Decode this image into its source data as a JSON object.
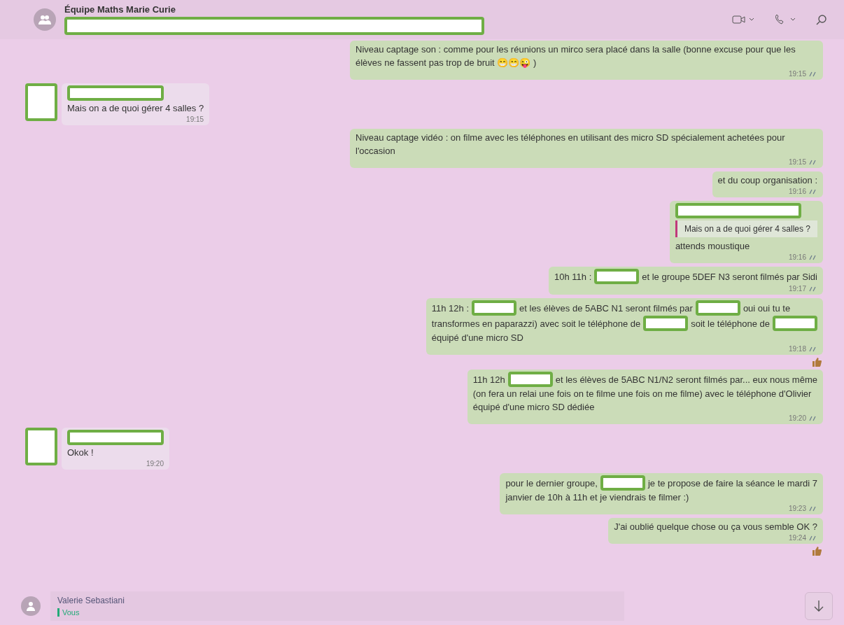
{
  "header": {
    "title": "Équipe Maths Marie Curie",
    "subtitle_redacted": true
  },
  "messages": [
    {
      "kind": "outgoing",
      "lines": [
        [
          {
            "kind": "text",
            "text": "Niveau captage son : comme pour les réunions un mirco sera placé dans la salle (bonne excuse pour que les élèves ne fassent pas trop de bruit 😁😁😜 )"
          }
        ]
      ],
      "time": "19:15"
    },
    {
      "kind": "incoming",
      "sender_redacted": true,
      "lines": [
        [
          {
            "kind": "text",
            "text": "Mais on a de quoi gérer 4 salles ?"
          }
        ]
      ],
      "time": "19:15"
    },
    {
      "kind": "outgoing",
      "lines": [
        [
          {
            "kind": "text",
            "text": "Niveau captage vidéo : on filme avec les téléphones en utilisant des micro SD spécialement achetées pour l'occasion"
          }
        ]
      ],
      "time": "19:15"
    },
    {
      "kind": "outgoing",
      "lines": [
        [
          {
            "kind": "text",
            "text": "et du coup organisation :"
          }
        ]
      ],
      "time": "19:16"
    },
    {
      "kind": "outgoing",
      "quote": {
        "text": "Mais on a de quoi gérer 4 salles ?"
      },
      "lines": [
        [
          {
            "kind": "text",
            "text": "attends moustique"
          }
        ]
      ],
      "time": "19:16"
    },
    {
      "kind": "outgoing",
      "lines": [
        [
          {
            "kind": "text",
            "text": "10h 11h :"
          },
          {
            "kind": "redacted"
          },
          {
            "kind": "text",
            "text": "et le groupe 5DEF N3 seront filmés par Sidi"
          }
        ]
      ],
      "time": "19:17"
    },
    {
      "kind": "outgoing",
      "lines": [
        [
          {
            "kind": "text",
            "text": "11h 12h :"
          },
          {
            "kind": "redacted"
          },
          {
            "kind": "text",
            "text": "et les élèves de 5ABC N1 seront filmés par"
          },
          {
            "kind": "redacted"
          },
          {
            "kind": "text",
            "text": "oui oui tu te"
          }
        ],
        [
          {
            "kind": "text",
            "text": "transformes en paparazzi) avec soit le téléphone de"
          },
          {
            "kind": "redacted"
          },
          {
            "kind": "text",
            "text": "soit le téléphone de"
          },
          {
            "kind": "redacted"
          }
        ],
        [
          {
            "kind": "text",
            "text": "équipé d'une micro SD"
          }
        ]
      ],
      "time": "19:18",
      "reaction": true
    },
    {
      "kind": "outgoing",
      "lines": [
        [
          {
            "kind": "text",
            "text": "11h 12h"
          },
          {
            "kind": "redacted"
          },
          {
            "kind": "text",
            "text": "et les élèves de 5ABC N1/N2 seront filmés par... eux nous même"
          }
        ],
        [
          {
            "kind": "text",
            "text": "(on fera un relai une fois on te filme une fois on me filme) avec le téléphone d'Olivier"
          }
        ],
        [
          {
            "kind": "text",
            "text": "équipé d'une micro SD dédiée"
          }
        ]
      ],
      "time": "19:20"
    },
    {
      "kind": "incoming",
      "sender_redacted": true,
      "lines": [
        [
          {
            "kind": "text",
            "text": "Okok !"
          }
        ]
      ],
      "time": "19:20"
    },
    {
      "kind": "outgoing",
      "lines": [
        [
          {
            "kind": "text",
            "text": "pour le dernier groupe,"
          },
          {
            "kind": "redacted"
          },
          {
            "kind": "text",
            "text": "je te propose de faire la séance le mardi 7"
          }
        ],
        [
          {
            "kind": "text",
            "text": "janvier de 10h à 11h et je viendrais te filmer :)"
          }
        ]
      ],
      "time": "19:23"
    },
    {
      "kind": "outgoing",
      "lines": [
        [
          {
            "kind": "text",
            "text": "J'ai oublié quelque chose ou ça vous semble OK ?"
          }
        ]
      ],
      "time": "19:24",
      "reaction": true
    }
  ],
  "reply_preview": {
    "name": "Valerie Sebastiani",
    "quoted_author": "Vous"
  }
}
